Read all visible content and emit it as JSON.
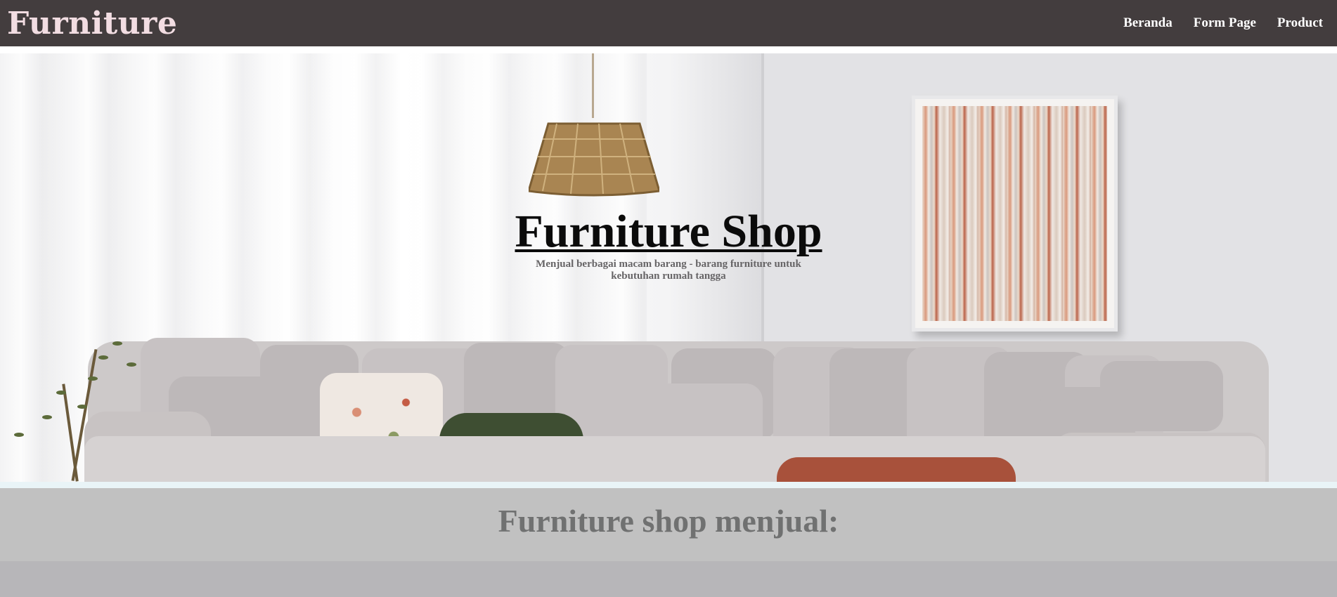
{
  "navbar": {
    "brand": "Furniture",
    "links": [
      "Beranda",
      "Form Page",
      "Product"
    ]
  },
  "hero": {
    "title": "Furniture Shop",
    "subtitle": "Menjual berbagai macam barang - barang furniture untuk kebutuhan rumah tangga",
    "image": "living-room-sofa-photo"
  },
  "section": {
    "title": "Furniture shop menjual:"
  },
  "colors": {
    "navbar_bg": "#433d3e",
    "brand": "#f2dde2",
    "section_band": "#c1c1c1",
    "section_title": "#707171"
  }
}
